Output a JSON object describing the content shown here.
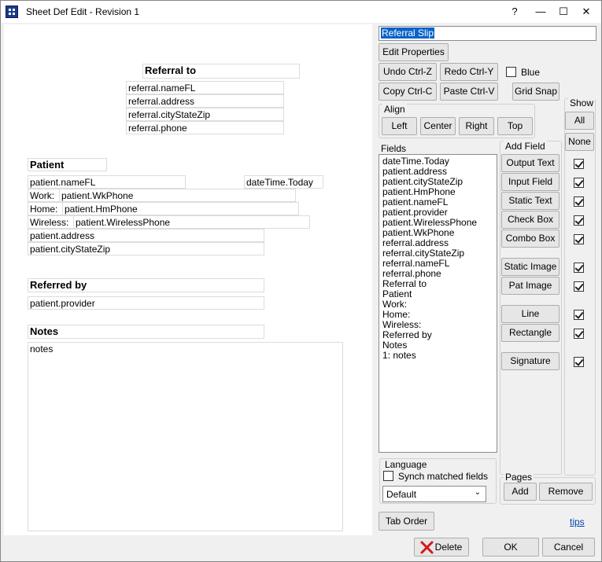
{
  "window": {
    "title": "Sheet Def Edit - Revision 1",
    "controls": {
      "help": "?",
      "minimize": "—",
      "maximize": "☐",
      "close": "✕"
    }
  },
  "canvas": {
    "referral_header": "Referral to",
    "referral_fields": [
      "referral.nameFL",
      "referral.address",
      "referral.cityStateZip",
      "referral.phone"
    ],
    "patient_header": "Patient",
    "patient_name": "patient.nameFL",
    "date_today": "dateTime.Today",
    "work_label": "Work:",
    "work_phone": "patient.WkPhone",
    "home_label": "Home:",
    "home_phone": "patient.HmPhone",
    "wireless_label": "Wireless:",
    "wireless_phone": "patient.WirelessPhone",
    "patient_address": "patient.address",
    "patient_city": "patient.cityStateZip",
    "referred_by_header": "Referred by",
    "patient_provider": "patient.provider",
    "notes_header": "Notes",
    "notes_field": "notes"
  },
  "panel": {
    "sheet_name": "Referral Slip",
    "edit_properties": "Edit Properties",
    "undo": "Undo Ctrl-Z",
    "redo": "Redo Ctrl-Y",
    "blue_label": "Blue",
    "copy": "Copy Ctrl-C",
    "paste": "Paste Ctrl-V",
    "grid_snap": "Grid Snap",
    "align": {
      "label": "Align",
      "left": "Left",
      "center": "Center",
      "right": "Right",
      "top": "Top"
    },
    "show": {
      "label": "Show",
      "all": "All",
      "none": "None"
    },
    "fields": {
      "label": "Fields",
      "items": [
        "dateTime.Today",
        "patient.address",
        "patient.cityStateZip",
        "patient.HmPhone",
        "patient.nameFL",
        "patient.provider",
        "patient.WirelessPhone",
        "patient.WkPhone",
        "referral.address",
        "referral.cityStateZip",
        "referral.nameFL",
        "referral.phone",
        "Referral to",
        "Patient",
        "Work:",
        "Home:",
        "Wireless:",
        "Referred by",
        "Notes",
        "1: notes"
      ]
    },
    "add_field": {
      "label": "Add Field",
      "output_text": "Output Text",
      "input_field": "Input Field",
      "static_text": "Static Text",
      "check_box": "Check Box",
      "combo_box": "Combo Box",
      "static_image": "Static Image",
      "pat_image": "Pat Image",
      "line": "Line",
      "rectangle": "Rectangle",
      "signature": "Signature"
    },
    "language": {
      "label": "Language",
      "synch_label": "Synch matched fields",
      "selected": "Default"
    },
    "pages": {
      "label": "Pages",
      "add": "Add",
      "remove": "Remove"
    },
    "tab_order": "Tab Order",
    "tips": "tips",
    "delete": "Delete",
    "ok": "OK",
    "cancel": "Cancel"
  }
}
